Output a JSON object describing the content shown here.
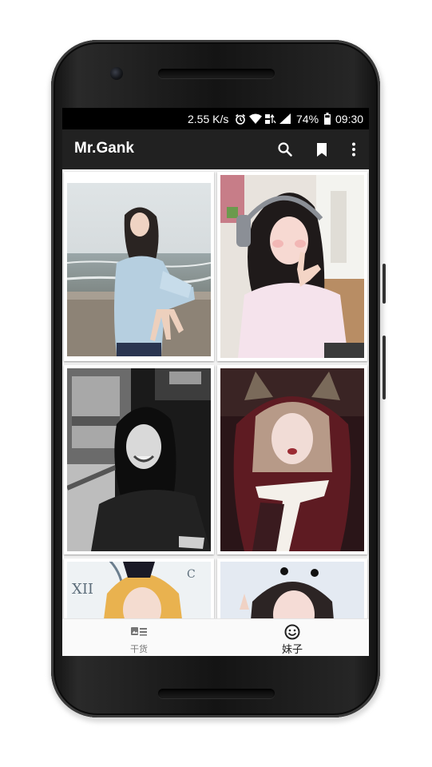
{
  "status_bar": {
    "speed": "2.55 K/s",
    "battery": "74%",
    "time": "09:30",
    "icons": [
      "alarm-icon",
      "wifi-icon",
      "network-type-icon",
      "signal-icon",
      "battery-icon"
    ]
  },
  "app_bar": {
    "title": "Mr.Gank",
    "actions": [
      "search-icon",
      "bookmark-icon",
      "more-vert-icon"
    ]
  },
  "photo_grid": {
    "items": [
      {
        "column": "left",
        "row": 1,
        "subject": "girl on beach in blue sweater"
      },
      {
        "column": "right",
        "row": 1,
        "subject": "girl with headphones pink sweater"
      },
      {
        "column": "left",
        "row": 2,
        "subject": "black and white girl smiling on train"
      },
      {
        "column": "right",
        "row": 2,
        "subject": "cosplay girl with fox ear hood"
      },
      {
        "column": "left",
        "row": 3,
        "subject": "blonde cosplay girl with clock"
      },
      {
        "column": "right",
        "row": 3,
        "subject": "girl with pigtails"
      }
    ]
  },
  "bottom_nav": {
    "tabs": [
      {
        "label": "干货",
        "icon": "article-icon",
        "selected": false
      },
      {
        "label": "妹子",
        "icon": "smiley-icon",
        "selected": true
      }
    ]
  },
  "colors": {
    "app_bar": "#212121",
    "status_bar": "#000000",
    "background": "#fafafa",
    "tab_selected": "#212121",
    "tab_unselected": "#757575"
  }
}
